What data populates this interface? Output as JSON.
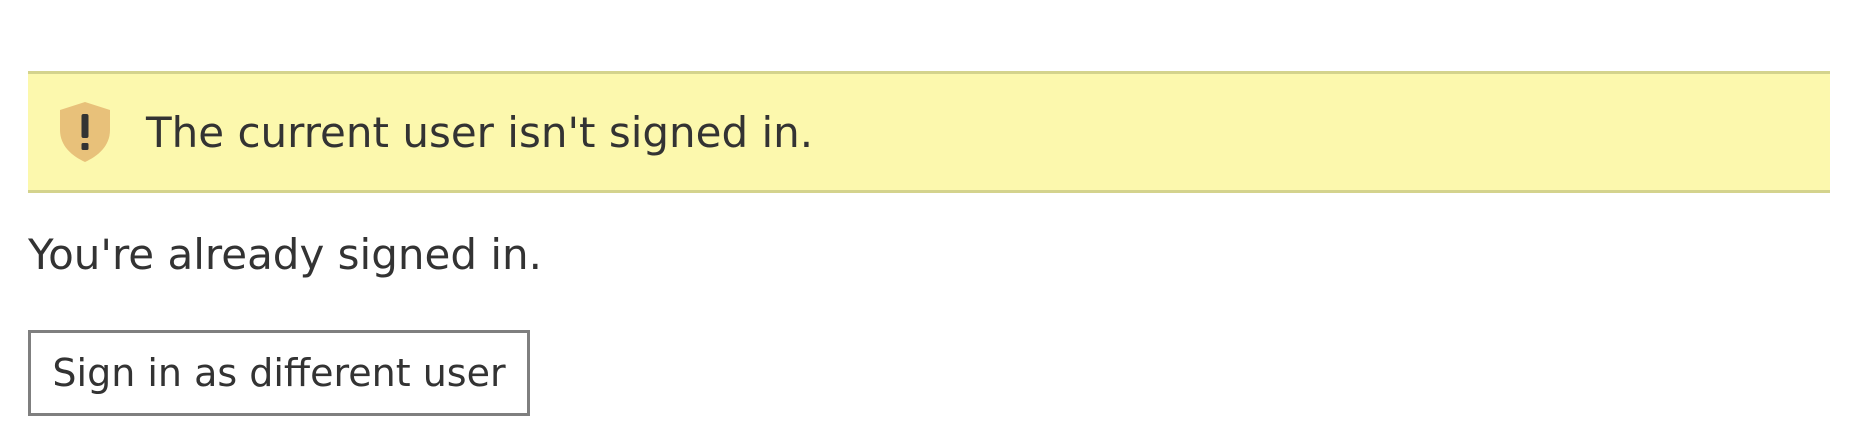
{
  "top_clipped_text": "",
  "warning": {
    "icon": "shield-exclamation-icon",
    "message": "The current user isn't signed in.",
    "background_color": "#fcf8ad",
    "border_color": "#d4d38d",
    "icon_color": "#e8c17a"
  },
  "status_message": "You're already signed in.",
  "switch_user_button": {
    "label": "Sign in as different user"
  }
}
